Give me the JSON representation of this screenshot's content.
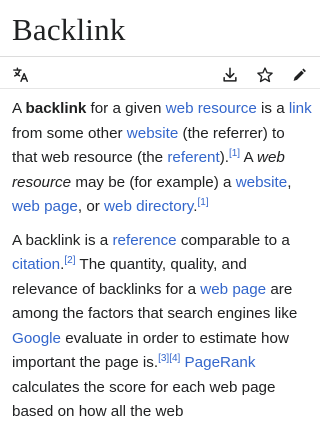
{
  "article": {
    "title": "Backlink"
  },
  "toolbar": {
    "icons": [
      "language-icon",
      "download-icon",
      "star-icon",
      "edit-icon"
    ]
  },
  "colors": {
    "link": "#3366cc",
    "text": "#202122"
  },
  "p1": {
    "t1": "A ",
    "b1": "backlink",
    "t2": " for a given ",
    "l1": "web resource",
    "t3": " is a ",
    "l2": "link",
    "t4": " from some other ",
    "l3": "website",
    "t5": " (the referrer) to that web resource (the ",
    "l4": "referent",
    "t6": ").",
    "r1": "[1]",
    "t7": " A ",
    "i1": "web resource",
    "t8": " may be (for example) a ",
    "l5": "website",
    "t9": ", ",
    "l6": "web page",
    "t10": ", or ",
    "l7": "web directory",
    "t11": ".",
    "r2": "[1]"
  },
  "p2": {
    "t1": "A backlink is a ",
    "l1": "reference",
    "t2": " comparable to a ",
    "l2": "citation",
    "t3": ".",
    "r1": "[2]",
    "t4": " The quantity, quality, and relevance of backlinks for a ",
    "l3": "web page",
    "t5": " are among the factors that search engines like ",
    "l4": "Google",
    "t6": " evaluate in order to estimate how important the page is.",
    "r2": "[3]",
    "r3": "[4]",
    "t7": " ",
    "l5": "PageRank",
    "t8": " calculates the score for each web page based on how all the web"
  }
}
